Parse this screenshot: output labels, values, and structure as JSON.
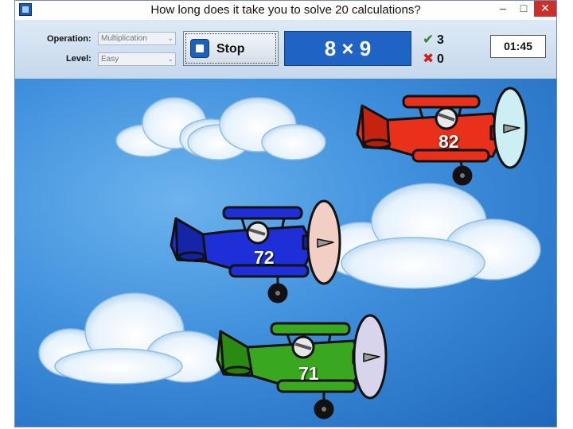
{
  "window": {
    "title": "How long does it take you to solve 20 calculations?"
  },
  "toolbar": {
    "operation_label": "Operation:",
    "operation_value": "Multiplication",
    "level_label": "Level:",
    "level_value": "Easy",
    "stop_label": "Stop",
    "problem": "8 × 9",
    "correct_count": "3",
    "wrong_count": "0",
    "timer": "01:45"
  },
  "planes": [
    {
      "color": "red",
      "answer": "82"
    },
    {
      "color": "blue",
      "answer": "72"
    },
    {
      "color": "green",
      "answer": "71"
    }
  ],
  "colors": {
    "red_plane": "#e8301a",
    "blue_plane": "#1e2fd8",
    "green_plane": "#3aa81e",
    "problem_bg": "#1f64c4",
    "sky": "#3f8fdc"
  }
}
